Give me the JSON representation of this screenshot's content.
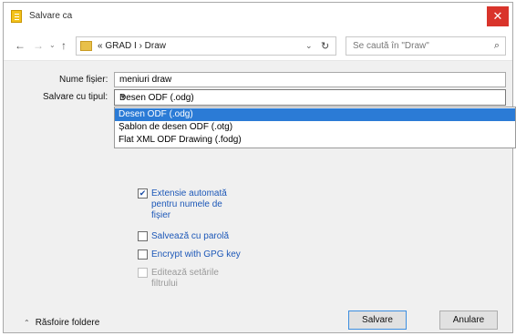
{
  "window": {
    "title": "Salvare ca",
    "close_label": "✕"
  },
  "nav": {
    "back_icon": "←",
    "forward_icon": "→",
    "dropdown_icon": "⌄",
    "up_icon": "↑",
    "breadcrumb": "« GRAD I › Draw",
    "refresh_icon": "↻",
    "search_placeholder": "Se caută în \"Draw\"",
    "search_icon": "⌕"
  },
  "form": {
    "filename_label": "Nume fișier:",
    "filename_value": "meniuri draw",
    "type_label": "Salvare cu tipul:",
    "type_value": "Desen ODF (.odg)",
    "type_options": [
      "Desen ODF (.odg)",
      "Șablon de desen ODF (.otg)",
      "Flat XML ODF Drawing (.fodg)"
    ],
    "selected_option_index": 0
  },
  "options": {
    "auto_extension": {
      "line1": "Extensie automată",
      "line2": "pentru numele de",
      "line3": "fișier",
      "checked": true
    },
    "save_password": {
      "label": "Salvează cu parolă",
      "checked": false
    },
    "encrypt_gpg": {
      "label": "Encrypt with GPG key",
      "checked": false
    },
    "edit_filter": {
      "line1": "Editează setările",
      "line2": "filtrului",
      "checked": false,
      "enabled": false
    }
  },
  "footer": {
    "browse_folders": "Răsfoire foldere",
    "save_button": "Salvare",
    "cancel_button": "Anulare"
  }
}
